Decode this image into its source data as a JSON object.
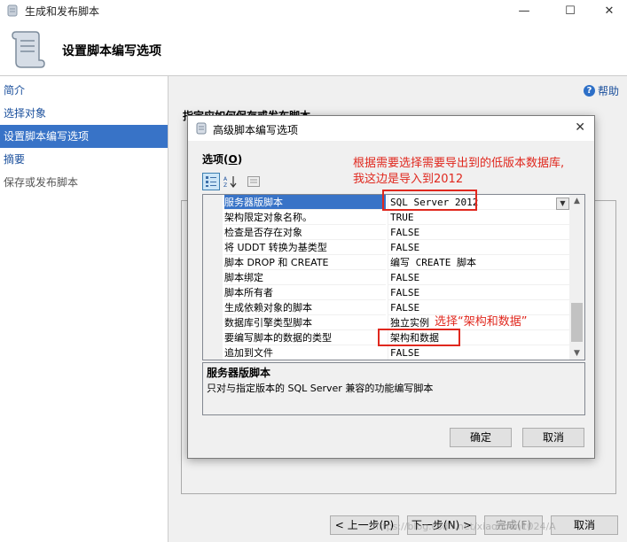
{
  "window": {
    "title": "生成和发布脚本",
    "minimize": "—",
    "maximize": "☐",
    "close": "✕"
  },
  "header": {
    "title": "设置脚本编写选项"
  },
  "sidebar": {
    "items": [
      {
        "label": "简介",
        "state": "normal"
      },
      {
        "label": "选择对象",
        "state": "normal"
      },
      {
        "label": "设置脚本编写选项",
        "state": "active"
      },
      {
        "label": "摘要",
        "state": "normal"
      },
      {
        "label": "保存或发布脚本",
        "state": "disabled"
      }
    ]
  },
  "main": {
    "help_label": "帮助",
    "heading": "指定应如何保存或发布脚本。"
  },
  "footer": {
    "prev": "< 上一步(P)",
    "next": "下一步(N) >",
    "finish": "完成(F)",
    "cancel": "取消"
  },
  "dialog": {
    "title": "高级脚本编写选项",
    "close": "✕",
    "options_label_prefix": "选项(",
    "options_label_key": "O",
    "options_label_suffix": ")",
    "rows": [
      {
        "name": "服务器版脚本",
        "value": "SQL Server 2012",
        "selected": true
      },
      {
        "name": "架构限定对象名称。",
        "value": "TRUE"
      },
      {
        "name": "检查是否存在对象",
        "value": "FALSE"
      },
      {
        "name": "将 UDDT 转换为基类型",
        "value": "FALSE"
      },
      {
        "name": "脚本 DROP 和 CREATE",
        "value": "编写 CREATE 脚本"
      },
      {
        "name": "脚本绑定",
        "value": "FALSE"
      },
      {
        "name": "脚本所有者",
        "value": "FALSE"
      },
      {
        "name": "生成依赖对象的脚本",
        "value": "FALSE"
      },
      {
        "name": "数据库引擎类型脚本",
        "value": "独立实例"
      },
      {
        "name": "要编写脚本的数据的类型",
        "value": "架构和数据"
      },
      {
        "name": "追加到文件",
        "value": "FALSE"
      }
    ],
    "description_title": "服务器版脚本",
    "description_body": "只对与指定版本的 SQL Server 兼容的功能编写脚本",
    "ok": "确定",
    "cancel": "取消"
  },
  "annotations": {
    "note1_line1": "根据需要选择需要导出到的低版本数据库,",
    "note1_line2": "我这边是导入到2012",
    "note2": "选择“架构和数据”"
  },
  "watermark": "https://blog.csdn.net/xiaochen1024/A",
  "colors": {
    "accent": "#3873c7",
    "annotation": "#e0281e"
  }
}
